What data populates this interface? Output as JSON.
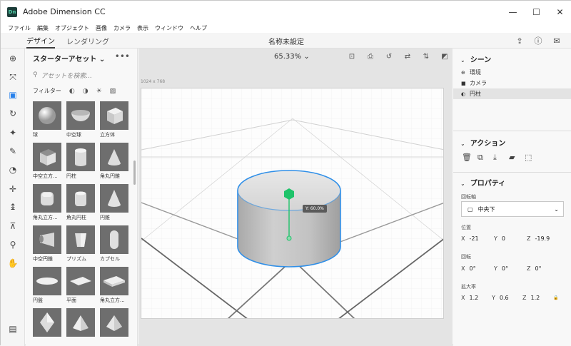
{
  "app": {
    "logo_text": "Dn",
    "title": "Adobe Dimension CC"
  },
  "window_controls": {
    "minimize": "—",
    "maximize": "☐",
    "close": "✕"
  },
  "menu": [
    "ファイル",
    "編集",
    "オブジェクト",
    "画像",
    "カメラ",
    "表示",
    "ウィンドウ",
    "ヘルプ"
  ],
  "header": {
    "tab_design": "デザイン",
    "tab_render": "レンダリング",
    "document_title": "名称未設定",
    "icons": [
      "share-icon",
      "help-icon",
      "feedback-icon"
    ]
  },
  "tools": [
    "add-icon",
    "select-icon",
    "select-box-icon",
    "orbit-icon",
    "magic-wand-icon",
    "sample-icon",
    "pan-camera-icon",
    "move-icon",
    "dolly-icon",
    "horizon-icon",
    "zoom-icon",
    "hand-icon",
    "panel-toggle-icon"
  ],
  "assets": {
    "title": "スターターアセット",
    "search_placeholder": "アセットを検索...",
    "filter_label": "フィルター",
    "items": [
      {
        "label": "球",
        "shape": "sphere"
      },
      {
        "label": "中空球",
        "shape": "hemisphere"
      },
      {
        "label": "立方体",
        "shape": "cube"
      },
      {
        "label": "中空立方...",
        "shape": "hollow-cube"
      },
      {
        "label": "円柱",
        "shape": "cylinder"
      },
      {
        "label": "角丸円錐",
        "shape": "cone"
      },
      {
        "label": "角丸立方...",
        "shape": "rounded-cube"
      },
      {
        "label": "角丸円柱",
        "shape": "rounded-cylinder"
      },
      {
        "label": "円錐",
        "shape": "cone"
      },
      {
        "label": "中空円錐",
        "shape": "hollow-cone"
      },
      {
        "label": "プリズム",
        "shape": "prism"
      },
      {
        "label": "カプセル",
        "shape": "capsule"
      },
      {
        "label": "円盤",
        "shape": "disc"
      },
      {
        "label": "平面",
        "shape": "plane"
      },
      {
        "label": "角丸立方...",
        "shape": "rounded-slab"
      },
      {
        "label": "",
        "shape": "octahedron"
      },
      {
        "label": "",
        "shape": "pyramid"
      },
      {
        "label": "",
        "shape": "pyramid"
      }
    ]
  },
  "viewport": {
    "zoom": "65.33%",
    "canvas_size": "1024 x 768",
    "tooltip": "Y: 60.0%",
    "icons": [
      "fit-icon",
      "camera-icon",
      "camera-rotate-icon",
      "camera-pan-icon",
      "camera-dolly-icon",
      "render-preview-icon"
    ]
  },
  "scene": {
    "title": "シーン",
    "items": [
      {
        "label": "環境",
        "icon": "globe-icon",
        "selected": false
      },
      {
        "label": "カメラ",
        "icon": "camera-icon",
        "selected": false
      },
      {
        "label": "円柱",
        "icon": "shape-icon",
        "selected": true
      }
    ]
  },
  "actions": {
    "title": "アクション",
    "icons": [
      "delete-icon",
      "duplicate-icon",
      "drop-icon",
      "group-icon",
      "export-icon"
    ]
  },
  "properties": {
    "title": "プロパティ",
    "pivot_label": "回転軸",
    "pivot_value": "中央下",
    "position_label": "位置",
    "position": {
      "x": "-21",
      "y": "0",
      "z": "-19.9"
    },
    "rotation_label": "回転",
    "rotation": {
      "x": "0°",
      "y": "0°",
      "z": "0°"
    },
    "scale_label": "拡大率",
    "scale": {
      "x": "1.2",
      "y": "0.6",
      "z": "1.2"
    }
  },
  "colors": {
    "selection": "#2f8fe8",
    "gizmo": "#1ec36a",
    "accent": "#2680eb"
  }
}
